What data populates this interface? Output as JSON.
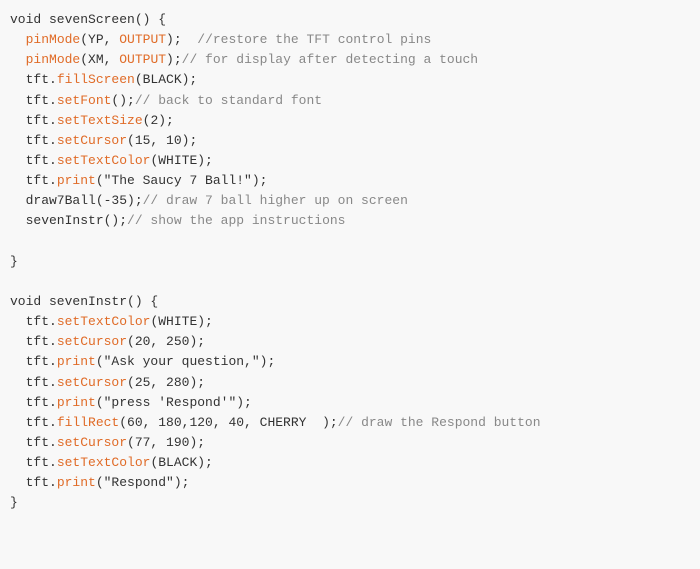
{
  "code": {
    "lines": [
      {
        "id": 1,
        "parts": [
          {
            "t": "void sevenScreen() {",
            "c": "default"
          }
        ]
      },
      {
        "id": 2,
        "parts": [
          {
            "t": "  ",
            "c": "default"
          },
          {
            "t": "pinMode",
            "c": "method"
          },
          {
            "t": "(YP, ",
            "c": "default"
          },
          {
            "t": "OUTPUT",
            "c": "method"
          },
          {
            "t": ");  //restore the TFT control pins",
            "c": "comment"
          }
        ]
      },
      {
        "id": 3,
        "parts": [
          {
            "t": "  ",
            "c": "default"
          },
          {
            "t": "pinMode",
            "c": "method"
          },
          {
            "t": "(XM, ",
            "c": "default"
          },
          {
            "t": "OUTPUT",
            "c": "method"
          },
          {
            "t": ");//  for display after detecting a touch",
            "c": "comment"
          }
        ]
      },
      {
        "id": 4,
        "parts": [
          {
            "t": "  tft.",
            "c": "default"
          },
          {
            "t": "fillScreen",
            "c": "method"
          },
          {
            "t": "(BLACK);",
            "c": "default"
          }
        ]
      },
      {
        "id": 5,
        "parts": [
          {
            "t": "  tft.",
            "c": "default"
          },
          {
            "t": "setFont",
            "c": "method"
          },
          {
            "t": "();// back to standard font",
            "c": "comment"
          }
        ]
      },
      {
        "id": 6,
        "parts": [
          {
            "t": "  tft.",
            "c": "default"
          },
          {
            "t": "setTextSize",
            "c": "method"
          },
          {
            "t": "(2);",
            "c": "default"
          }
        ]
      },
      {
        "id": 7,
        "parts": [
          {
            "t": "  tft.",
            "c": "default"
          },
          {
            "t": "setCursor",
            "c": "method"
          },
          {
            "t": "(15, 10);",
            "c": "default"
          }
        ]
      },
      {
        "id": 8,
        "parts": [
          {
            "t": "  tft.",
            "c": "default"
          },
          {
            "t": "setTextColor",
            "c": "method"
          },
          {
            "t": "(WHITE);",
            "c": "default"
          }
        ]
      },
      {
        "id": 9,
        "parts": [
          {
            "t": "  tft.",
            "c": "default"
          },
          {
            "t": "print",
            "c": "method"
          },
          {
            "t": "(\"The Saucy 7 Ball!\");",
            "c": "default"
          }
        ]
      },
      {
        "id": 10,
        "parts": [
          {
            "t": "  draw7Ball(-35);// draw 7 ball higher up on screen",
            "c": "comment-inline"
          }
        ]
      },
      {
        "id": 11,
        "parts": [
          {
            "t": "  sevenInstr();// show the app instructions",
            "c": "comment-inline"
          }
        ]
      },
      {
        "id": 12,
        "parts": [
          {
            "t": "",
            "c": "blank"
          }
        ]
      },
      {
        "id": 13,
        "parts": [
          {
            "t": "}",
            "c": "default"
          }
        ]
      },
      {
        "id": 14,
        "parts": [
          {
            "t": "",
            "c": "blank"
          }
        ]
      },
      {
        "id": 15,
        "parts": [
          {
            "t": "void sevenInstr() {",
            "c": "default"
          }
        ]
      },
      {
        "id": 16,
        "parts": [
          {
            "t": "  tft.",
            "c": "default"
          },
          {
            "t": "setTextColor",
            "c": "method"
          },
          {
            "t": "(WHITE);",
            "c": "default"
          }
        ]
      },
      {
        "id": 17,
        "parts": [
          {
            "t": "  tft.",
            "c": "default"
          },
          {
            "t": "setCursor",
            "c": "method"
          },
          {
            "t": "(20, 250);",
            "c": "default"
          }
        ]
      },
      {
        "id": 18,
        "parts": [
          {
            "t": "  tft.",
            "c": "default"
          },
          {
            "t": "print",
            "c": "method"
          },
          {
            "t": "(\"Ask your question,\");",
            "c": "default"
          }
        ]
      },
      {
        "id": 19,
        "parts": [
          {
            "t": "  tft.",
            "c": "default"
          },
          {
            "t": "setCursor",
            "c": "method"
          },
          {
            "t": "(25, 280);",
            "c": "default"
          }
        ]
      },
      {
        "id": 20,
        "parts": [
          {
            "t": "  tft.",
            "c": "default"
          },
          {
            "t": "print",
            "c": "method"
          },
          {
            "t": "(\"press 'Respond'\");",
            "c": "default"
          }
        ]
      },
      {
        "id": 21,
        "parts": [
          {
            "t": "  tft.",
            "c": "default"
          },
          {
            "t": "fillRect",
            "c": "method"
          },
          {
            "t": "(60, 180,120, 40, CHERRY  );// draw the Respond button",
            "c": "comment-inline-rect"
          }
        ]
      },
      {
        "id": 22,
        "parts": [
          {
            "t": "  tft.",
            "c": "default"
          },
          {
            "t": "setCursor",
            "c": "method"
          },
          {
            "t": "(77, 190);",
            "c": "default"
          }
        ]
      },
      {
        "id": 23,
        "parts": [
          {
            "t": "  tft.",
            "c": "default"
          },
          {
            "t": "setTextColor",
            "c": "method"
          },
          {
            "t": "(BLACK);",
            "c": "default"
          }
        ]
      },
      {
        "id": 24,
        "parts": [
          {
            "t": "  tft.",
            "c": "default"
          },
          {
            "t": "print",
            "c": "method"
          },
          {
            "t": "(\"Respond\");",
            "c": "default"
          }
        ]
      },
      {
        "id": 25,
        "parts": [
          {
            "t": "}",
            "c": "default"
          }
        ]
      }
    ]
  }
}
